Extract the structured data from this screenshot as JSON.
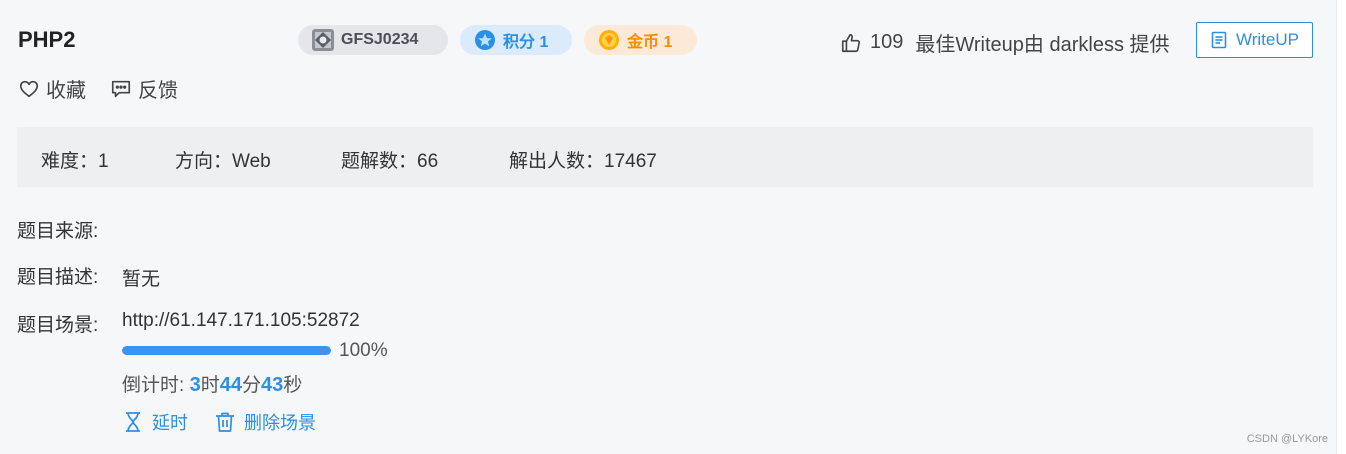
{
  "challenge": {
    "title": "PHP2",
    "id_badge": "GFSJ0234",
    "score_badge": "积分 1",
    "coin_badge": "金币 1",
    "likes": "109",
    "best_writeup": "最佳Writeup由 darkless 提供",
    "writeup_button": "WriteUP"
  },
  "actions": {
    "favorite": "收藏",
    "feedback": "反馈"
  },
  "stats": {
    "difficulty": "难度：1",
    "direction": "方向：Web",
    "solves": "题解数：66",
    "solvers": "解出人数：17467"
  },
  "details": {
    "source_label": "题目来源:",
    "desc_label": "题目描述:",
    "desc_value": "暂无",
    "scene_label": "题目场景:",
    "scene_url": "http://61.147.171.105:52872",
    "progress_value": 100,
    "progress_text": "100%",
    "countdown_prefix": "倒计时: ",
    "hours": "3",
    "hours_unit": "时",
    "minutes": "44",
    "minutes_unit": "分",
    "seconds": "43",
    "seconds_unit": "秒",
    "extend_label": "延时",
    "delete_label": "删除场景"
  },
  "watermark": "CSDN @LYKore",
  "colors": {
    "accent": "#2b8fe6",
    "coin": "#ff8a00",
    "progress": "#3b93f2"
  },
  "icons": {
    "id": "avatar-icon",
    "score": "star-icon",
    "coin": "coin-icon",
    "likes": "thumbs-up-icon",
    "writeup": "document-icon",
    "favorite": "heart-icon",
    "feedback": "comment-icon",
    "extend": "hourglass-icon",
    "delete": "trash-icon"
  }
}
